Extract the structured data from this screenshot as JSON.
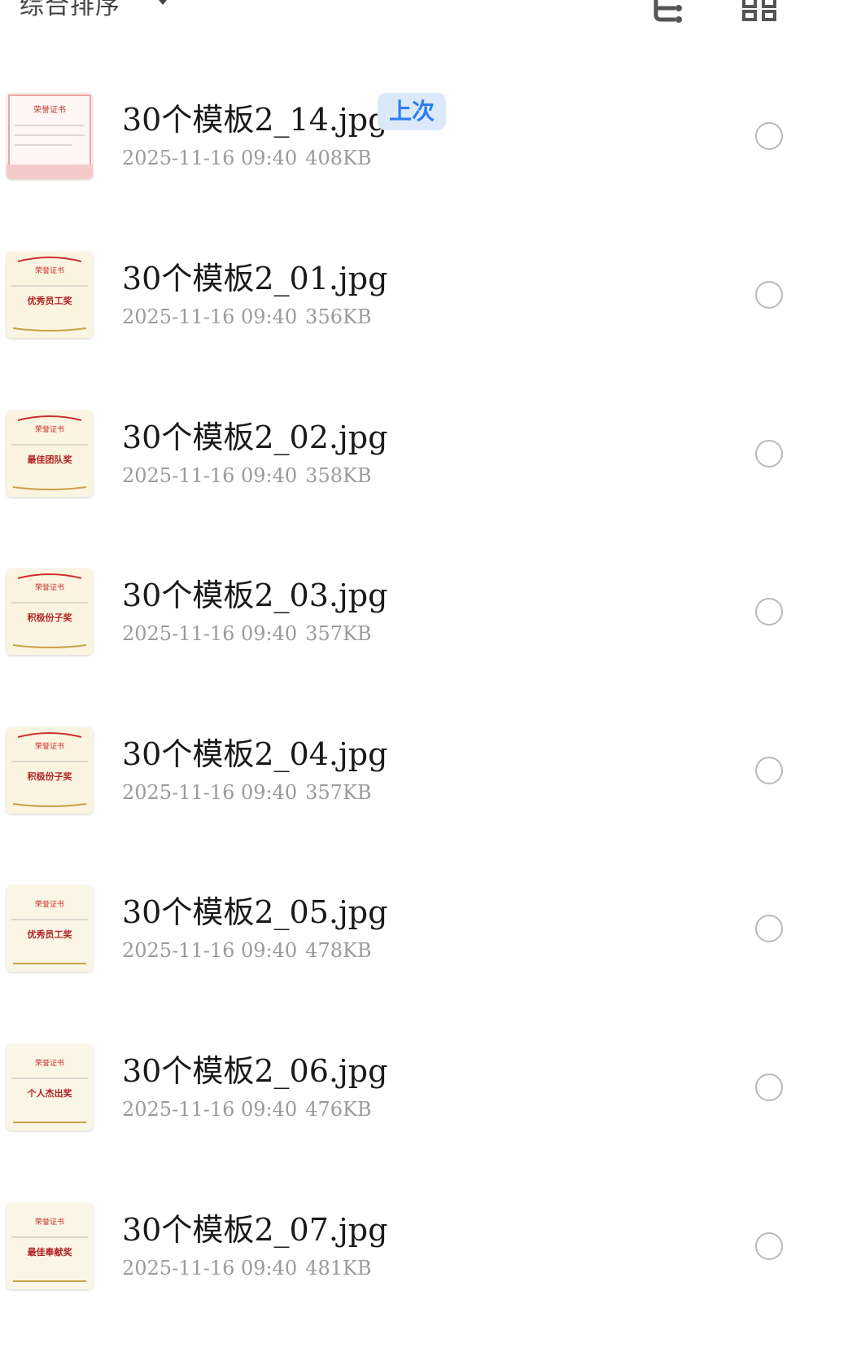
{
  "header": {
    "sort_label": "综合排序",
    "icons": [
      "sort-dropdown-caret-icon",
      "tree-view-icon",
      "grid-view-icon"
    ]
  },
  "colors": {
    "badge_bg": "#dce9fb",
    "badge_text": "#2d7ef0",
    "meta_text": "#9b9b9b",
    "name_text": "#1a1a1a"
  },
  "files": [
    {
      "name": "30个模板2_14.jpg",
      "date": "2025-11-16 09:40",
      "size": "408KB",
      "badge": "上次",
      "thumb_title": "荣誉证书",
      "thumb_award": ""
    },
    {
      "name": "30个模板2_01.jpg",
      "date": "2025-11-16 09:40",
      "size": "356KB",
      "thumb_title": "荣誉证书",
      "thumb_award": "优秀员工奖"
    },
    {
      "name": "30个模板2_02.jpg",
      "date": "2025-11-16 09:40",
      "size": "358KB",
      "thumb_title": "荣誉证书",
      "thumb_award": "最佳团队奖"
    },
    {
      "name": "30个模板2_03.jpg",
      "date": "2025-11-16 09:40",
      "size": "357KB",
      "thumb_title": "荣誉证书",
      "thumb_award": "积极份子奖"
    },
    {
      "name": "30个模板2_04.jpg",
      "date": "2025-11-16 09:40",
      "size": "357KB",
      "thumb_title": "荣誉证书",
      "thumb_award": "积极份子奖"
    },
    {
      "name": "30个模板2_05.jpg",
      "date": "2025-11-16 09:40",
      "size": "478KB",
      "thumb_title": "荣誉证书",
      "thumb_award": "优秀员工奖"
    },
    {
      "name": "30个模板2_06.jpg",
      "date": "2025-11-16 09:40",
      "size": "476KB",
      "thumb_title": "荣誉证书",
      "thumb_award": "个人杰出奖"
    },
    {
      "name": "30个模板2_07.jpg",
      "date": "2025-11-16 09:40",
      "size": "481KB",
      "thumb_title": "荣誉证书",
      "thumb_award": "最佳奉献奖"
    }
  ]
}
